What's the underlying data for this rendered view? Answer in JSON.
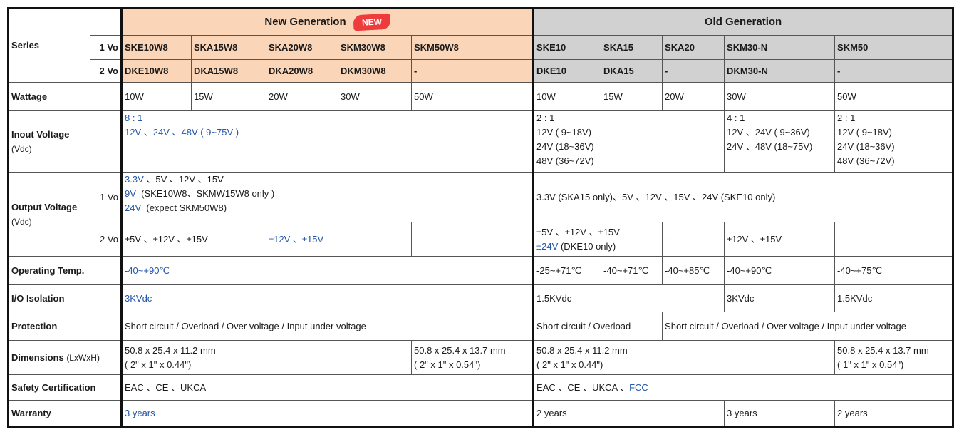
{
  "headers": {
    "series": "Series",
    "vo1": "1 Vo",
    "vo2": "2 Vo",
    "new_generation": "New Generation",
    "new_badge": "NEW",
    "old_generation": "Old Generation"
  },
  "new_models": {
    "one_vo": [
      "SKE10W8",
      "SKA15W8",
      "SKA20W8",
      "SKM30W8",
      "SKM50W8"
    ],
    "two_vo": [
      "DKE10W8",
      "DKA15W8",
      "DKA20W8",
      "DKM30W8",
      "-"
    ]
  },
  "old_models": {
    "one_vo": [
      "SKE10",
      "SKA15",
      "SKA20",
      "SKM30-N",
      "SKM50"
    ],
    "two_vo": [
      "DKE10",
      "DKA15",
      "-",
      "DKM30-N",
      "-"
    ]
  },
  "rows": {
    "wattage": {
      "label": "Wattage",
      "new": [
        "10W",
        "15W",
        "20W",
        "30W",
        "50W"
      ],
      "old": [
        "10W",
        "15W",
        "20W",
        "30W",
        "50W"
      ]
    },
    "input_voltage": {
      "label": "Inout Voltage",
      "unit": "(Vdc)",
      "new_ratio": "8 : 1",
      "new_range": "12V 、24V 、48V ( 9~75V )",
      "old_a": [
        "2 : 1",
        "12V ( 9~18V)",
        "24V (18~36V)",
        "48V (36~72V)"
      ],
      "old_b": [
        "4 : 1",
        "12V 、24V ( 9~36V)",
        "24V 、48V (18~75V)"
      ],
      "old_c": [
        "2 : 1",
        "12V ( 9~18V)",
        "24V (18~36V)",
        "48V (36~72V)"
      ]
    },
    "output_voltage": {
      "label": "Output Voltage",
      "unit": "(Vdc)",
      "vo1": "1 Vo",
      "vo2": "2 Vo",
      "new_1vo_line1_blue": "3.3V",
      "new_1vo_line1_rest": "、5V 、12V 、15V",
      "new_1vo_line2_blue": "9V",
      "new_1vo_line2_rest": "(SKE10W8、SKMW15W8 only )",
      "new_1vo_line3_blue": "24V",
      "new_1vo_line3_rest": "(expect SKM50W8)",
      "old_1vo": "3.3V (SKA15 only)、5V 、12V 、15V 、24V (SKE10 only)",
      "new_2vo_a": "±5V 、±12V 、±15V",
      "new_2vo_b": "±12V 、±15V",
      "new_2vo_c": "-",
      "old_2vo_a_line1": "±5V 、±12V 、±15V",
      "old_2vo_a_line2_blue": "±24V",
      "old_2vo_a_line2_rest": "(DKE10 only)",
      "old_2vo_b": "-",
      "old_2vo_c": "±12V 、±15V",
      "old_2vo_d": "-"
    },
    "operating_temp": {
      "label": "Operating Temp.",
      "new": "-40~+90℃",
      "old": [
        "-25~+71℃",
        "-40~+71℃",
        "-40~+85℃",
        "-40~+90℃",
        "-40~+75℃"
      ]
    },
    "io_isolation": {
      "label": "I/O Isolation",
      "new": "3KVdc",
      "old_a": "1.5KVdc",
      "old_b": "3KVdc",
      "old_c": "1.5KVdc"
    },
    "protection": {
      "label": "Protection",
      "new": "Short circuit / Overload / Over voltage / Input under voltage",
      "old_a": "Short circuit / Overload",
      "old_b": "Short circuit / Overload / Over voltage / Input under voltage"
    },
    "dimensions": {
      "label": "Dimensions",
      "unit": "(LxWxH)",
      "new_a": [
        "50.8 x 25.4 x 11.2 mm",
        "( 2\" x 1\" x  0.44\")"
      ],
      "new_b": [
        "50.8 x 25.4 x 13.7 mm",
        "( 2\" x 1\" x  0.54\")"
      ],
      "old_a": [
        "50.8 x 25.4 x 11.2 mm",
        "( 2\" x 1\" x  0.44\")"
      ],
      "old_b": [
        "50.8 x 25.4 x 13.7 mm",
        "( 1\" x 1\" x  0.54\")"
      ]
    },
    "safety": {
      "label": "Safety Certification",
      "new": "EAC 、CE  、UKCA",
      "old": "EAC 、CE  、UKCA 、",
      "old_blue": "FCC"
    },
    "warranty": {
      "label": "Warranty",
      "new": "3 years",
      "old_a": "2 years",
      "old_b": "3 years",
      "old_c": "2 years"
    }
  },
  "colors": {
    "new_header": "#fbd5b7",
    "old_header": "#d1d1d1",
    "highlight_text": "#2255aa",
    "badge": "#ee3b3b"
  }
}
